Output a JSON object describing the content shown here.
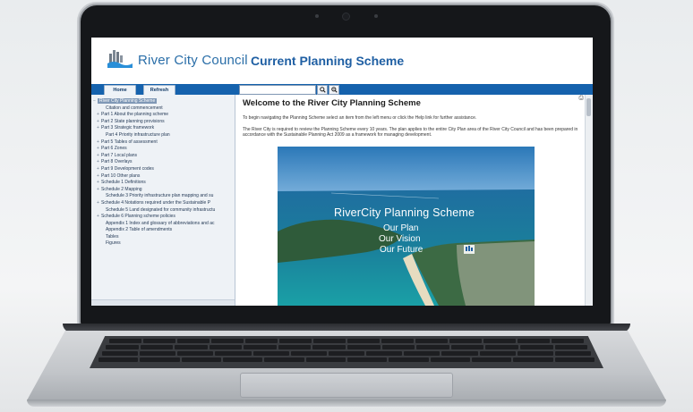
{
  "header": {
    "logo_text": "River City Council",
    "site_title": "Current Planning Scheme"
  },
  "nav": {
    "home_label": "Home",
    "refresh_label": "Refresh",
    "search_placeholder": "",
    "search_icon": "magnifier-icon",
    "advanced_search_icon": "advanced-search-icon"
  },
  "sidebar": {
    "items": [
      {
        "label": "River City Planning Scheme",
        "level": "root",
        "toggle": "−"
      },
      {
        "label": "Citation and commencement",
        "level": "leaf",
        "toggle": ""
      },
      {
        "label": "Part 1 About the planning scheme",
        "level": "child",
        "toggle": "+"
      },
      {
        "label": "Part 2 State planning provisions",
        "level": "child",
        "toggle": "+"
      },
      {
        "label": "Part 3 Strategic framework",
        "level": "child",
        "toggle": "+"
      },
      {
        "label": "Part 4 Priority infrastructure plan",
        "level": "leaf",
        "toggle": ""
      },
      {
        "label": "Part 5 Tables of assessment",
        "level": "child",
        "toggle": "+"
      },
      {
        "label": "Part 6 Zones",
        "level": "child",
        "toggle": "+"
      },
      {
        "label": "Part 7 Local plans",
        "level": "child",
        "toggle": "+"
      },
      {
        "label": "Part 8 Overlays",
        "level": "child",
        "toggle": "+"
      },
      {
        "label": "Part 9 Development codes",
        "level": "child",
        "toggle": "+"
      },
      {
        "label": "Part 10 Other plans",
        "level": "child",
        "toggle": "+"
      },
      {
        "label": "Schedule 1 Definitions",
        "level": "child",
        "toggle": "+"
      },
      {
        "label": "Schedule 2 Mapping",
        "level": "child",
        "toggle": "+"
      },
      {
        "label": "Schedule 3 Priority infrastructure plan mapping and su",
        "level": "leaf",
        "toggle": ""
      },
      {
        "label": "Schedule 4 Notations required under the Sustainable P",
        "level": "child",
        "toggle": "+"
      },
      {
        "label": "Schedule 5 Land designated for community infrastructu",
        "level": "leaf",
        "toggle": ""
      },
      {
        "label": "Schedule 6 Planning scheme policies",
        "level": "child",
        "toggle": "+"
      },
      {
        "label": "Appendix 1 Index and glossary of abbreviations and ac",
        "level": "leaf",
        "toggle": ""
      },
      {
        "label": "Appendix 2 Table of amendments",
        "level": "leaf",
        "toggle": ""
      },
      {
        "label": "Tables",
        "level": "leaf",
        "toggle": ""
      },
      {
        "label": "Figures",
        "level": "leaf",
        "toggle": ""
      }
    ]
  },
  "main": {
    "heading": "Welcome to the River City Planning Scheme",
    "intro": "To begin navigating the Planning Scheme select an item from the left menu or click the Help link for further assistance.",
    "body": "The River City is required to review the Planning Scheme every 10 years. The plan applies to the entire City Plan area of the River City Council and has been prepared in accordance with the Sustainable Planning Act 2009 as a framework for managing development.",
    "hero": {
      "title": "RiverCity Planning Scheme",
      "lines": [
        "Our Plan",
        "Our Vision",
        "Our Future"
      ]
    }
  },
  "colors": {
    "navbar": "#1562ad",
    "title_blue": "#1f5fa3",
    "sidebar_bg": "#eef2f6"
  }
}
